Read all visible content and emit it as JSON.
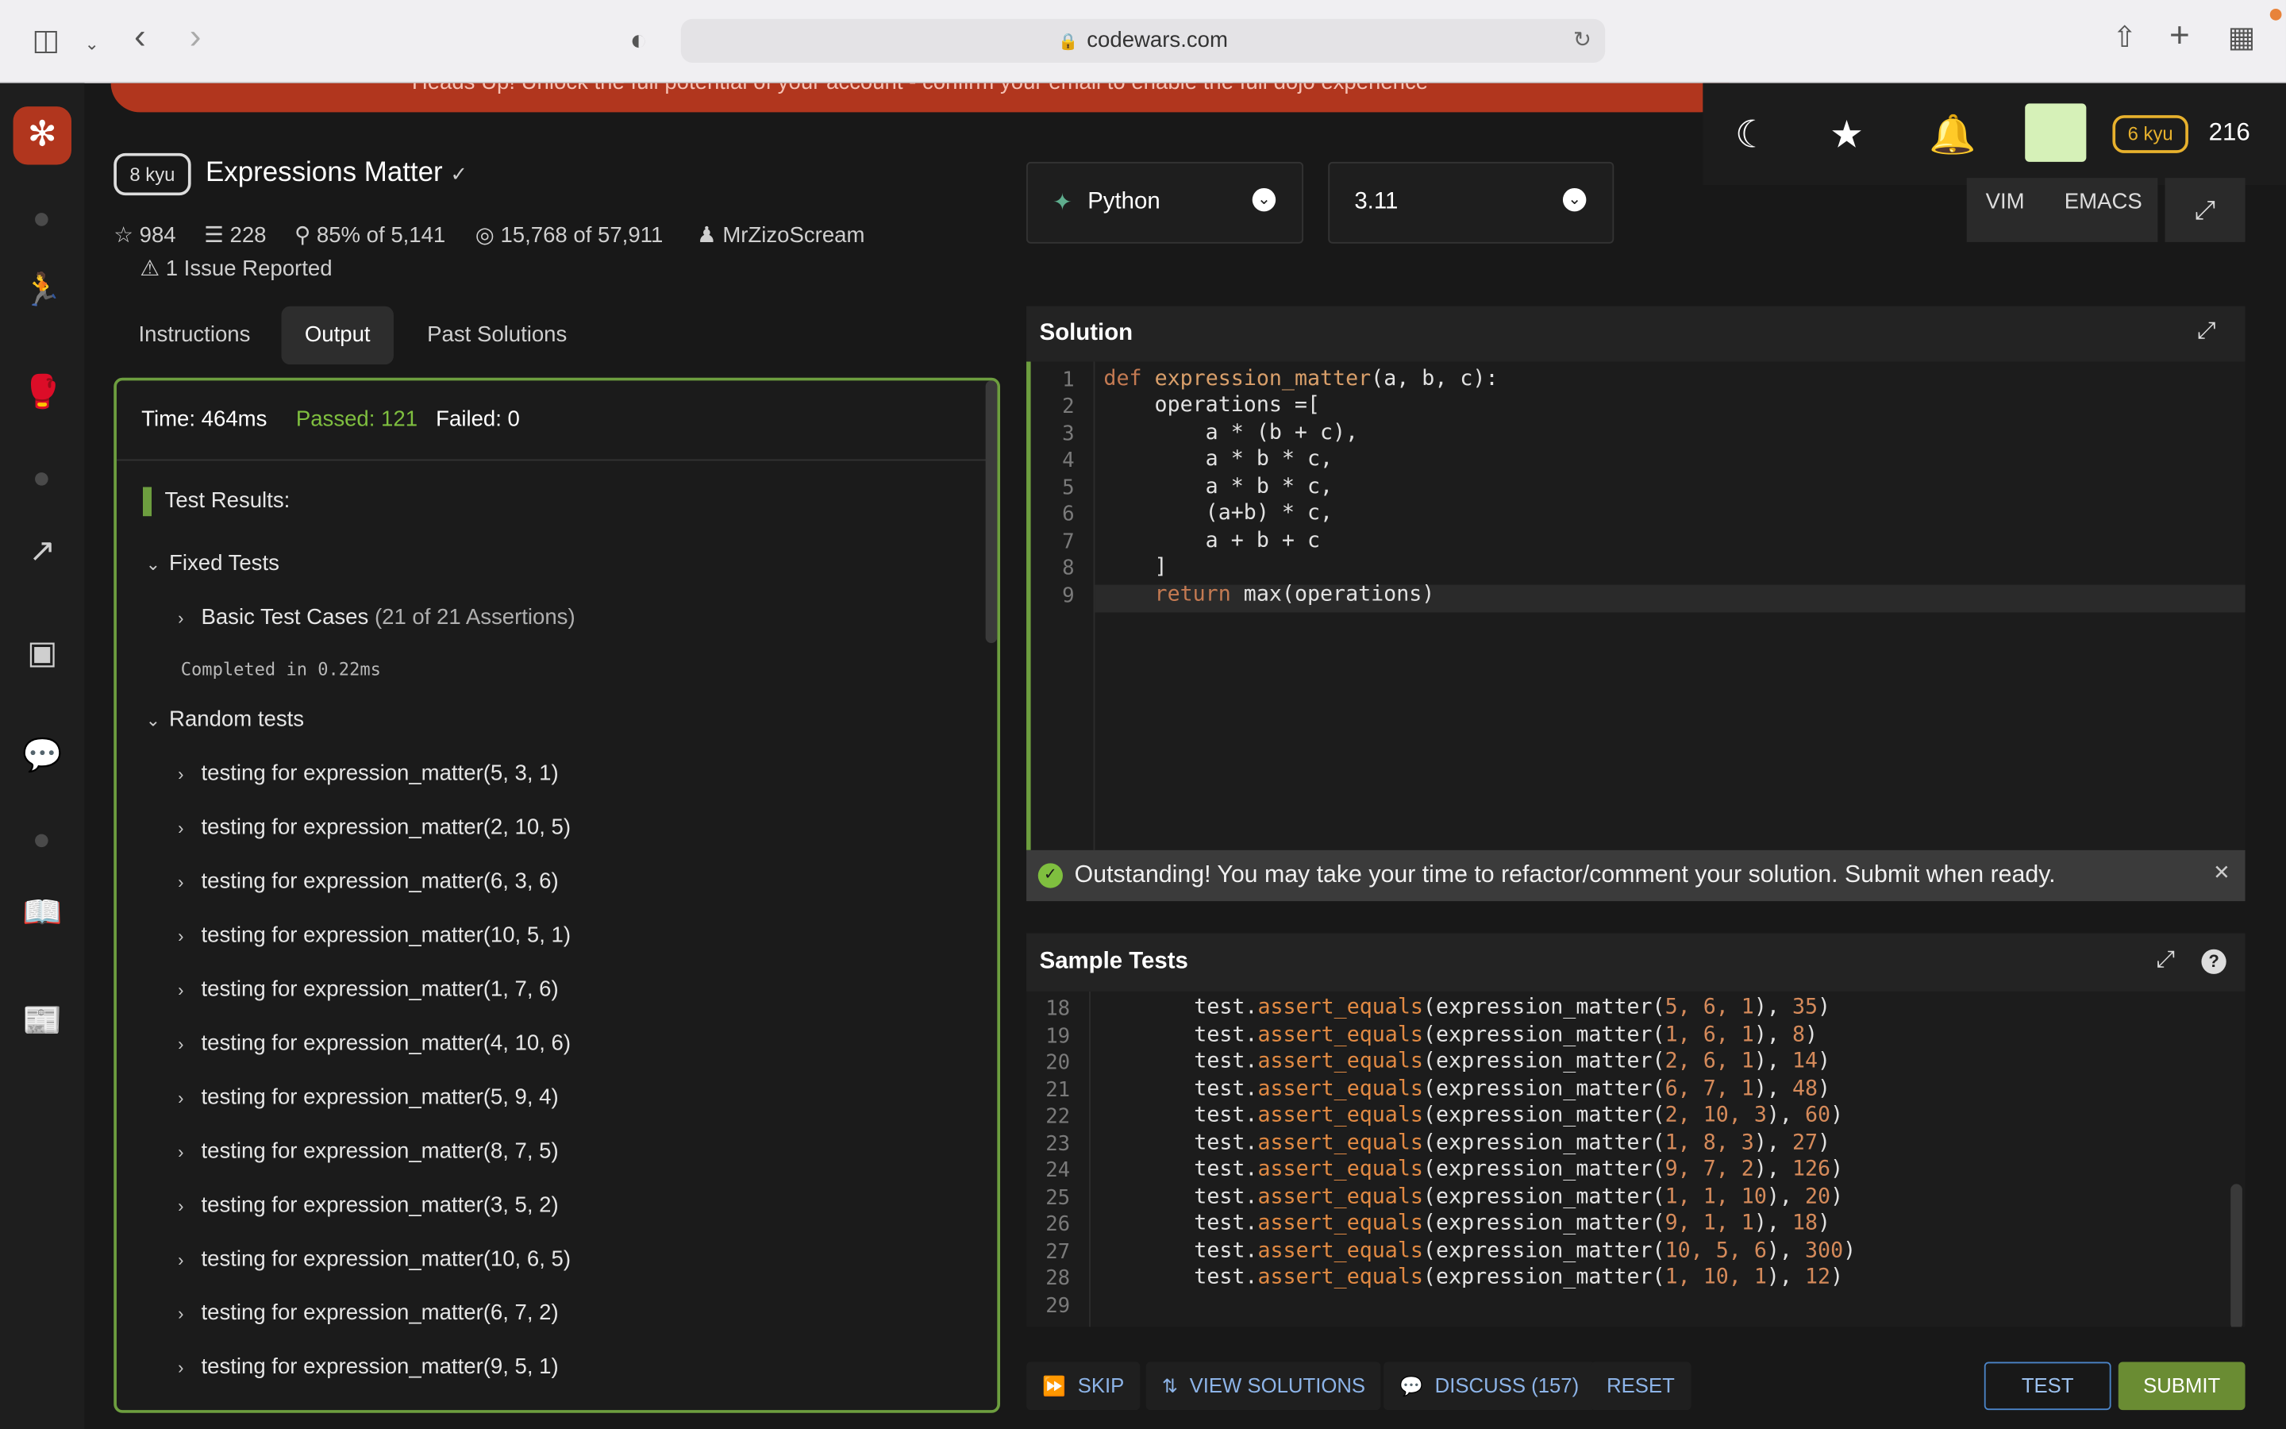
{
  "browser": {
    "url": "codewars.com"
  },
  "banner": {
    "text": "Heads Up!   Unlock the full potential of your account - confirm your email to enable the full dojo experience"
  },
  "user": {
    "rank": "6 kyu",
    "honor": "216"
  },
  "kata": {
    "kyu": "8 kyu",
    "title": "Expressions Matter",
    "stars": "984",
    "collections": "228",
    "satisfaction": "85% of 5,141",
    "completed": "15,768 of 57,911",
    "author": "MrZizoScream",
    "issues": "1 Issue Reported"
  },
  "tabs": [
    {
      "label": "Instructions"
    },
    {
      "label": "Output"
    },
    {
      "label": "Past Solutions"
    }
  ],
  "output": {
    "time": "Time: 464ms",
    "passed": "Passed: 121",
    "failed": "Failed: 0",
    "results_title": "Test Results:",
    "fixed_tests": "Fixed Tests",
    "basic_cases": "Basic Test Cases",
    "basic_assertions": "(21 of 21 Assertions)",
    "completed_in": "Completed in 0.22ms",
    "random_tests": "Random tests",
    "random_items": [
      "testing for expression_matter(5, 3, 1)",
      "testing for expression_matter(2, 10, 5)",
      "testing for expression_matter(6, 3, 6)",
      "testing for expression_matter(10, 5, 1)",
      "testing for expression_matter(1, 7, 6)",
      "testing for expression_matter(4, 10, 6)",
      "testing for expression_matter(5, 9, 4)",
      "testing for expression_matter(8, 7, 5)",
      "testing for expression_matter(3, 5, 2)",
      "testing for expression_matter(10, 6, 5)",
      "testing for expression_matter(6, 7, 2)",
      "testing for expression_matter(9, 5, 1)"
    ]
  },
  "editor": {
    "language": "Python",
    "version": "3.11",
    "mode_vim": "VIM",
    "mode_emacs": "EMACS",
    "solution_title": "Solution",
    "solution_line_numbers": [
      "1",
      "2",
      "3",
      "4",
      "5",
      "6",
      "7",
      "8",
      "9"
    ],
    "success_message": "Outstanding! You may take your time to refactor/comment your solution. Submit when ready.",
    "tests_title": "Sample Tests",
    "tests_line_numbers": [
      "18",
      "19",
      "20",
      "21",
      "22",
      "23",
      "24",
      "25",
      "26",
      "27",
      "28",
      "29"
    ],
    "tests_args": [
      [
        "5, 6, 1",
        "35"
      ],
      [
        "1, 6, 1",
        "8"
      ],
      [
        "2, 6, 1",
        "14"
      ],
      [
        "6, 7, 1",
        "48"
      ],
      [
        "2, 10, 3",
        "60"
      ],
      [
        "1, 8, 3",
        "27"
      ],
      [
        "9, 7, 2",
        "126"
      ],
      [
        "1, 1, 10",
        "20"
      ],
      [
        "9, 1, 1",
        "18"
      ],
      [
        "10, 5, 6",
        "300"
      ],
      [
        "1, 10, 1",
        "12"
      ]
    ]
  },
  "actions": {
    "skip": "SKIP",
    "view_solutions": "VIEW SOLUTIONS",
    "discuss": "DISCUSS (157)",
    "reset": "RESET",
    "test": "TEST",
    "submit": "SUBMIT"
  },
  "colors": {
    "accent_green": "#6d9e3f",
    "banner_red": "#b1361e",
    "rank_yellow": "#e7b12d",
    "link_blue": "#8db4e8"
  }
}
